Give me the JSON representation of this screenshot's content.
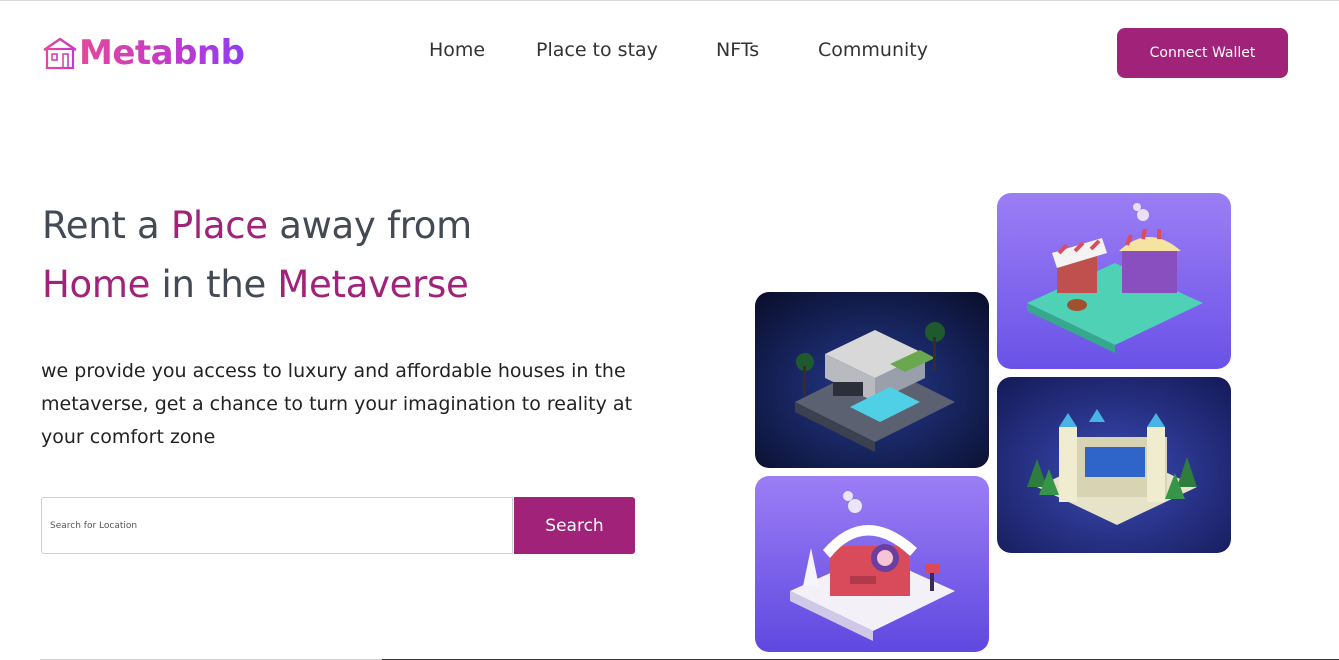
{
  "header": {
    "logo_text": "Metabnb",
    "logo_icon": "house-icon",
    "nav": [
      {
        "label": "Home"
      },
      {
        "label": "Place to stay"
      },
      {
        "label": "NFTs"
      },
      {
        "label": "Community"
      }
    ],
    "connect_label": "Connect Wallet"
  },
  "hero": {
    "title_part1": "Rent a ",
    "title_accent1": "Place",
    "title_part2": " away from",
    "title_accent2": "Home",
    "title_part3": " in the ",
    "title_accent3": "Metaverse",
    "description": "we provide you access to luxury and affordable houses in the metaverse, get a chance to turn your imagination to reality at your comfort zone"
  },
  "search": {
    "placeholder": "Search for Location",
    "value": "",
    "button_label": "Search"
  },
  "gallery": [
    {
      "name": "villa-image"
    },
    {
      "name": "market-stall-image"
    },
    {
      "name": "castle-image"
    },
    {
      "name": "snow-cabin-image"
    }
  ],
  "colors": {
    "brand": "#a02279",
    "heading_gray": "#434a54",
    "logo_gradient_start": "#e5479b",
    "logo_gradient_end": "#8f3df5"
  }
}
